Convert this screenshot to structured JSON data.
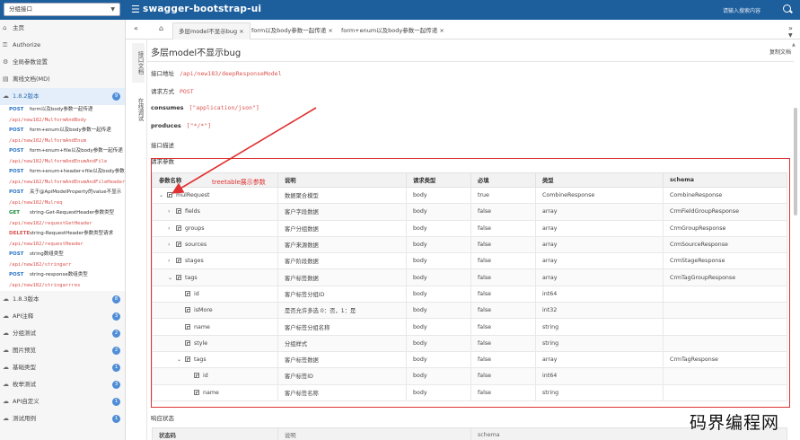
{
  "topbar": {
    "group_select": "分组接口",
    "app_title": "swagger-bootstrap-ui",
    "search_placeholder": "请输入搜索内容"
  },
  "sidebar": {
    "items": [
      {
        "label": "主页",
        "icon": "home-icon"
      },
      {
        "label": "Authorize",
        "icon": "key-icon"
      },
      {
        "label": "全局参数设置",
        "icon": "settings-icon"
      },
      {
        "label": "离线文档(MD)",
        "icon": "document-icon"
      }
    ],
    "active_group": {
      "label": "1.8.2版本",
      "badge": "9"
    },
    "apis": [
      {
        "method": "POST",
        "title": "form以及body参数一起传递",
        "path": "/api/new182/MulformAndBody"
      },
      {
        "method": "POST",
        "title": "form+enum以及body参数一起传递",
        "path": "/api/new182/MulformAndEnum"
      },
      {
        "method": "POST",
        "title": "form+enum+file以及body参数一起传递",
        "path": "/api/new182/MulformAndEnumAndFile"
      },
      {
        "method": "POST",
        "title": "form+enum+header+file以及body参数",
        "path": "/api/new182/MulformAndEnumAndFileHeader"
      },
      {
        "method": "POST",
        "title": "关于@ApiModelProperty的value不显示",
        "path": "/api/new182/Mulreq"
      },
      {
        "method": "GET",
        "title": "string-Get-RequestHeader参数类型",
        "path": "/api/new182/requestGetHeader"
      },
      {
        "method": "DELETE",
        "title": "string-RequestHeader参数类型请求",
        "path": "/api/new182/requestHeader"
      },
      {
        "method": "POST",
        "title": "string数组类型",
        "path": "/api/new182/stringarr"
      },
      {
        "method": "POST",
        "title": "string-response数组类型",
        "path": "/api/new182/stringarrres"
      }
    ],
    "groups": [
      {
        "label": "1.8.3版本",
        "badge": "8"
      },
      {
        "label": "API注释",
        "badge": "3"
      },
      {
        "label": "分组测试",
        "badge": "2"
      },
      {
        "label": "图片预览",
        "badge": "2"
      },
      {
        "label": "基础类型",
        "badge": "1"
      },
      {
        "label": "枚举测试",
        "badge": "3"
      },
      {
        "label": "API自定义",
        "badge": "1"
      },
      {
        "label": "测试用例",
        "badge": "1"
      }
    ]
  },
  "tabs": [
    {
      "label": "多层model不显示bug"
    },
    {
      "label": "form以及body参数一起传递"
    },
    {
      "label": "form+enum以及body参数一起传递"
    }
  ],
  "vtabs": [
    "接口文档",
    "在线调试"
  ],
  "main": {
    "title": "多层model不显示bug",
    "copy_label": "复制文档",
    "url_label": "接口地址",
    "url_value": "/api/new183/deepResponseModel",
    "method_label": "请求方式",
    "method_value": "POST",
    "consumes_label": "consumes",
    "consumes_value": "[\"application/json\"]",
    "produces_label": "produces",
    "produces_value": "[\"*/*\"]",
    "desc_label": "接口描述",
    "params_label": "请求参数",
    "annotation": "treetable展示参数",
    "response_label": "响应状态"
  },
  "params": {
    "headers": [
      "参数名称",
      "说明",
      "请求类型",
      "必填",
      "类型",
      "schema"
    ],
    "rows": [
      {
        "level": 0,
        "toggle": "expanded",
        "name": "mulRequest",
        "desc": "数据聚合模型",
        "in": "body",
        "req": "true",
        "type": "CombineResponse",
        "schema": "CombineResponse"
      },
      {
        "level": 1,
        "toggle": "collapsed",
        "name": "fields",
        "desc": "客户字段数据",
        "in": "body",
        "req": "false",
        "type": "array",
        "schema": "CrmFieldGroupResponse"
      },
      {
        "level": 1,
        "toggle": "collapsed",
        "name": "groups",
        "desc": "客户分组数据",
        "in": "body",
        "req": "false",
        "type": "array",
        "schema": "CrmGroupResponse"
      },
      {
        "level": 1,
        "toggle": "collapsed",
        "name": "sources",
        "desc": "客户来源数据",
        "in": "body",
        "req": "false",
        "type": "array",
        "schema": "CrmSourceResponse"
      },
      {
        "level": 1,
        "toggle": "collapsed",
        "name": "stages",
        "desc": "客户阶段数据",
        "in": "body",
        "req": "false",
        "type": "array",
        "schema": "CrmStageResponse"
      },
      {
        "level": 1,
        "toggle": "expanded",
        "name": "tags",
        "desc": "客户标签数据",
        "in": "body",
        "req": "false",
        "type": "array",
        "schema": "CrmTagGroupResponse"
      },
      {
        "level": 2,
        "toggle": "none",
        "name": "id",
        "desc": "客户标签分组ID",
        "in": "body",
        "req": "false",
        "type": "int64",
        "schema": ""
      },
      {
        "level": 2,
        "toggle": "none",
        "name": "isMore",
        "desc": "是否允许多选 0：否，1：是",
        "in": "body",
        "req": "false",
        "type": "int32",
        "schema": ""
      },
      {
        "level": 2,
        "toggle": "none",
        "name": "name",
        "desc": "客户标签分组名称",
        "in": "body",
        "req": "false",
        "type": "string",
        "schema": ""
      },
      {
        "level": 2,
        "toggle": "none",
        "name": "style",
        "desc": "分组样式",
        "in": "body",
        "req": "false",
        "type": "string",
        "schema": ""
      },
      {
        "level": 2,
        "toggle": "expanded",
        "name": "tags",
        "desc": "客户标签数据",
        "in": "body",
        "req": "false",
        "type": "array",
        "schema": "CrmTagResponse"
      },
      {
        "level": 3,
        "toggle": "none",
        "name": "id",
        "desc": "客户标签ID",
        "in": "body",
        "req": "false",
        "type": "int64",
        "schema": ""
      },
      {
        "level": 3,
        "toggle": "none",
        "name": "name",
        "desc": "客户标签名称",
        "in": "body",
        "req": "false",
        "type": "string",
        "schema": ""
      }
    ]
  },
  "response": {
    "headers": [
      "状态码",
      "说明",
      "schema"
    ]
  },
  "watermark": "码界编程网",
  "colors": {
    "topbar": "#1d5e9c",
    "annotation": "#e03030",
    "path": "#d9534f"
  }
}
